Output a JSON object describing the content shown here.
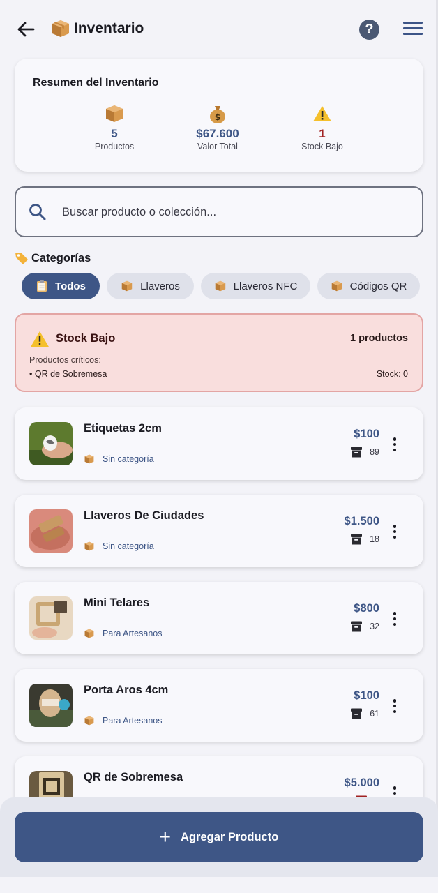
{
  "header": {
    "title": "Inventario",
    "back_icon": "arrow-left-icon",
    "title_icon": "package-icon",
    "help_icon": "question-icon",
    "menu_icon": "hamburger-menu-icon"
  },
  "summary": {
    "title": "Resumen del Inventario",
    "stats": [
      {
        "icon": "package-icon",
        "value": "5",
        "label": "Productos"
      },
      {
        "icon": "money-bag-icon",
        "value": "$67.600",
        "label": "Valor Total"
      },
      {
        "icon": "warning-icon",
        "value": "1",
        "label": "Stock Bajo"
      }
    ]
  },
  "search": {
    "placeholder": "Buscar producto o colección...",
    "value": ""
  },
  "categories": {
    "heading": "Categorías",
    "chips": [
      {
        "label": "Todos",
        "active": true,
        "icon": "clipboard-icon"
      },
      {
        "label": "Llaveros",
        "active": false,
        "icon": "package-icon"
      },
      {
        "label": "Llaveros NFC",
        "active": false,
        "icon": "package-icon"
      },
      {
        "label": "Códigos QR",
        "active": false,
        "icon": "package-icon"
      }
    ]
  },
  "low_stock": {
    "title": "Stock Bajo",
    "count": "1 productos",
    "subtitle": "Productos críticos:",
    "item": "• QR de Sobremesa",
    "item_stock": "Stock: 0"
  },
  "products": [
    {
      "name": "Etiquetas 2cm",
      "category": "Sin categoría",
      "price": "$100",
      "stock": "89",
      "low": false
    },
    {
      "name": "Llaveros De Ciudades",
      "category": "Sin categoría",
      "price": "$1.500",
      "stock": "18",
      "low": false
    },
    {
      "name": "Mini Telares",
      "category": "Para Artesanos",
      "price": "$800",
      "stock": "32",
      "low": false
    },
    {
      "name": "Porta Aros 4cm",
      "category": "Para Artesanos",
      "price": "$100",
      "stock": "61",
      "low": false
    },
    {
      "name": "QR de Sobremesa",
      "category": "",
      "price": "$5.000",
      "stock": "0",
      "low": true
    }
  ],
  "add_button": {
    "label": "Agregar Producto",
    "icon": "plus-icon"
  },
  "colors": {
    "primary": "#3e5686",
    "danger": "#a12222",
    "low_stock_bg": "#f9dedd"
  }
}
